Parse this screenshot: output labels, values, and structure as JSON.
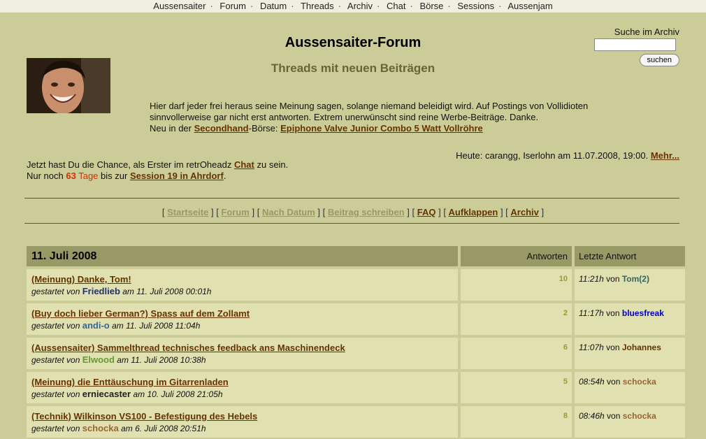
{
  "topnav": [
    "Aussensaiter",
    "Forum",
    "Datum",
    "Threads",
    "Archiv",
    "Chat",
    "Börse",
    "Sessions",
    "Aussenjam"
  ],
  "header": {
    "title": "Aussensaiter-Forum",
    "subtitle": "Threads mit neuen Beiträgen"
  },
  "search": {
    "label": "Suche im Archiv",
    "value": "",
    "button": "suchen"
  },
  "intro": {
    "line1": "Hier darf jeder frei heraus seine Meinung sagen, solange niemand beleidigt wird. Auf Postings von Vollidioten sinnvollerweise gar nicht erst antworten. Extrem unerwünscht sind reine Werbe-Beiträge. Danke.",
    "neu_prefix": "Neu in der ",
    "neu_link": "Secondhand",
    "neu_mid": "-Börse: ",
    "neu_item": "Epiphone Valve Junior Combo 5 Watt Vollröhre"
  },
  "today": {
    "text": "Heute: carangg, Iserlohn am 11.07.2008, 19:00. ",
    "link": "Mehr..."
  },
  "chance": {
    "prefix": "Jetzt hast Du die Chance, als Erster im retrOheadz ",
    "link": "Chat",
    "suffix": " zu sein.",
    "session_prefix": "Nur noch ",
    "days": "63",
    "days_label": " Tage",
    "session_mid": " bis zur ",
    "session_link": "Session 19 in Ahrdorf",
    "session_suffix": "."
  },
  "navbar": [
    {
      "label": "Startseite",
      "dim": true
    },
    {
      "label": "Forum",
      "dim": true
    },
    {
      "label": "Nach Datum",
      "dim": true
    },
    {
      "label": "Beitrag schreiben",
      "dim": true
    },
    {
      "label": "FAQ",
      "dim": false
    },
    {
      "label": "Aufklappen",
      "dim": false
    },
    {
      "label": "Archiv",
      "dim": false
    }
  ],
  "table": {
    "date": "11. Juli 2008",
    "col_answers": "Antworten",
    "col_last": "Letzte Antwort",
    "started_by": "gestartet von",
    "on": "am",
    "by": "von",
    "rows": [
      {
        "title": "(Meinung) Danke, Tom!",
        "author": "Friedlieb",
        "author_color": "#223366",
        "date": "11. Juli 2008 00:01h",
        "answers": "10",
        "last_time": "11:21h",
        "last_user": "Tom(2)",
        "last_color": "#336666"
      },
      {
        "title": "(Buy doch lieber German?) Spass auf dem Zollamt",
        "author": "andi-o",
        "author_color": "#336699",
        "date": "11. Juli 2008 11:04h",
        "answers": "2",
        "last_time": "11:17h",
        "last_user": "bluesfreak",
        "last_color": "#0000cc"
      },
      {
        "title": "(Aussensaiter) Sammelthread technisches feedback ans Maschinendeck",
        "author": "Elwood",
        "author_color": "#669933",
        "date": "11. Juli 2008 10:38h",
        "answers": "6",
        "last_time": "11:07h",
        "last_user": "Johannes",
        "last_color": "#663300"
      },
      {
        "title": "(Meinung) die Enttäuschung im Gitarrenladen",
        "author": "erniecaster",
        "author_color": "#222222",
        "date": "10. Juli 2008 21:05h",
        "answers": "5",
        "last_time": "08:54h",
        "last_user": "schocka",
        "last_color": "#996633"
      },
      {
        "title": "(Technik) Wilkinson VS100 - Befestigung des Hebels",
        "author": "schocka",
        "author_color": "#996633",
        "date": "6. Juli 2008 20:51h",
        "answers": "8",
        "last_time": "08:46h",
        "last_user": "schocka",
        "last_color": "#996633"
      }
    ]
  }
}
